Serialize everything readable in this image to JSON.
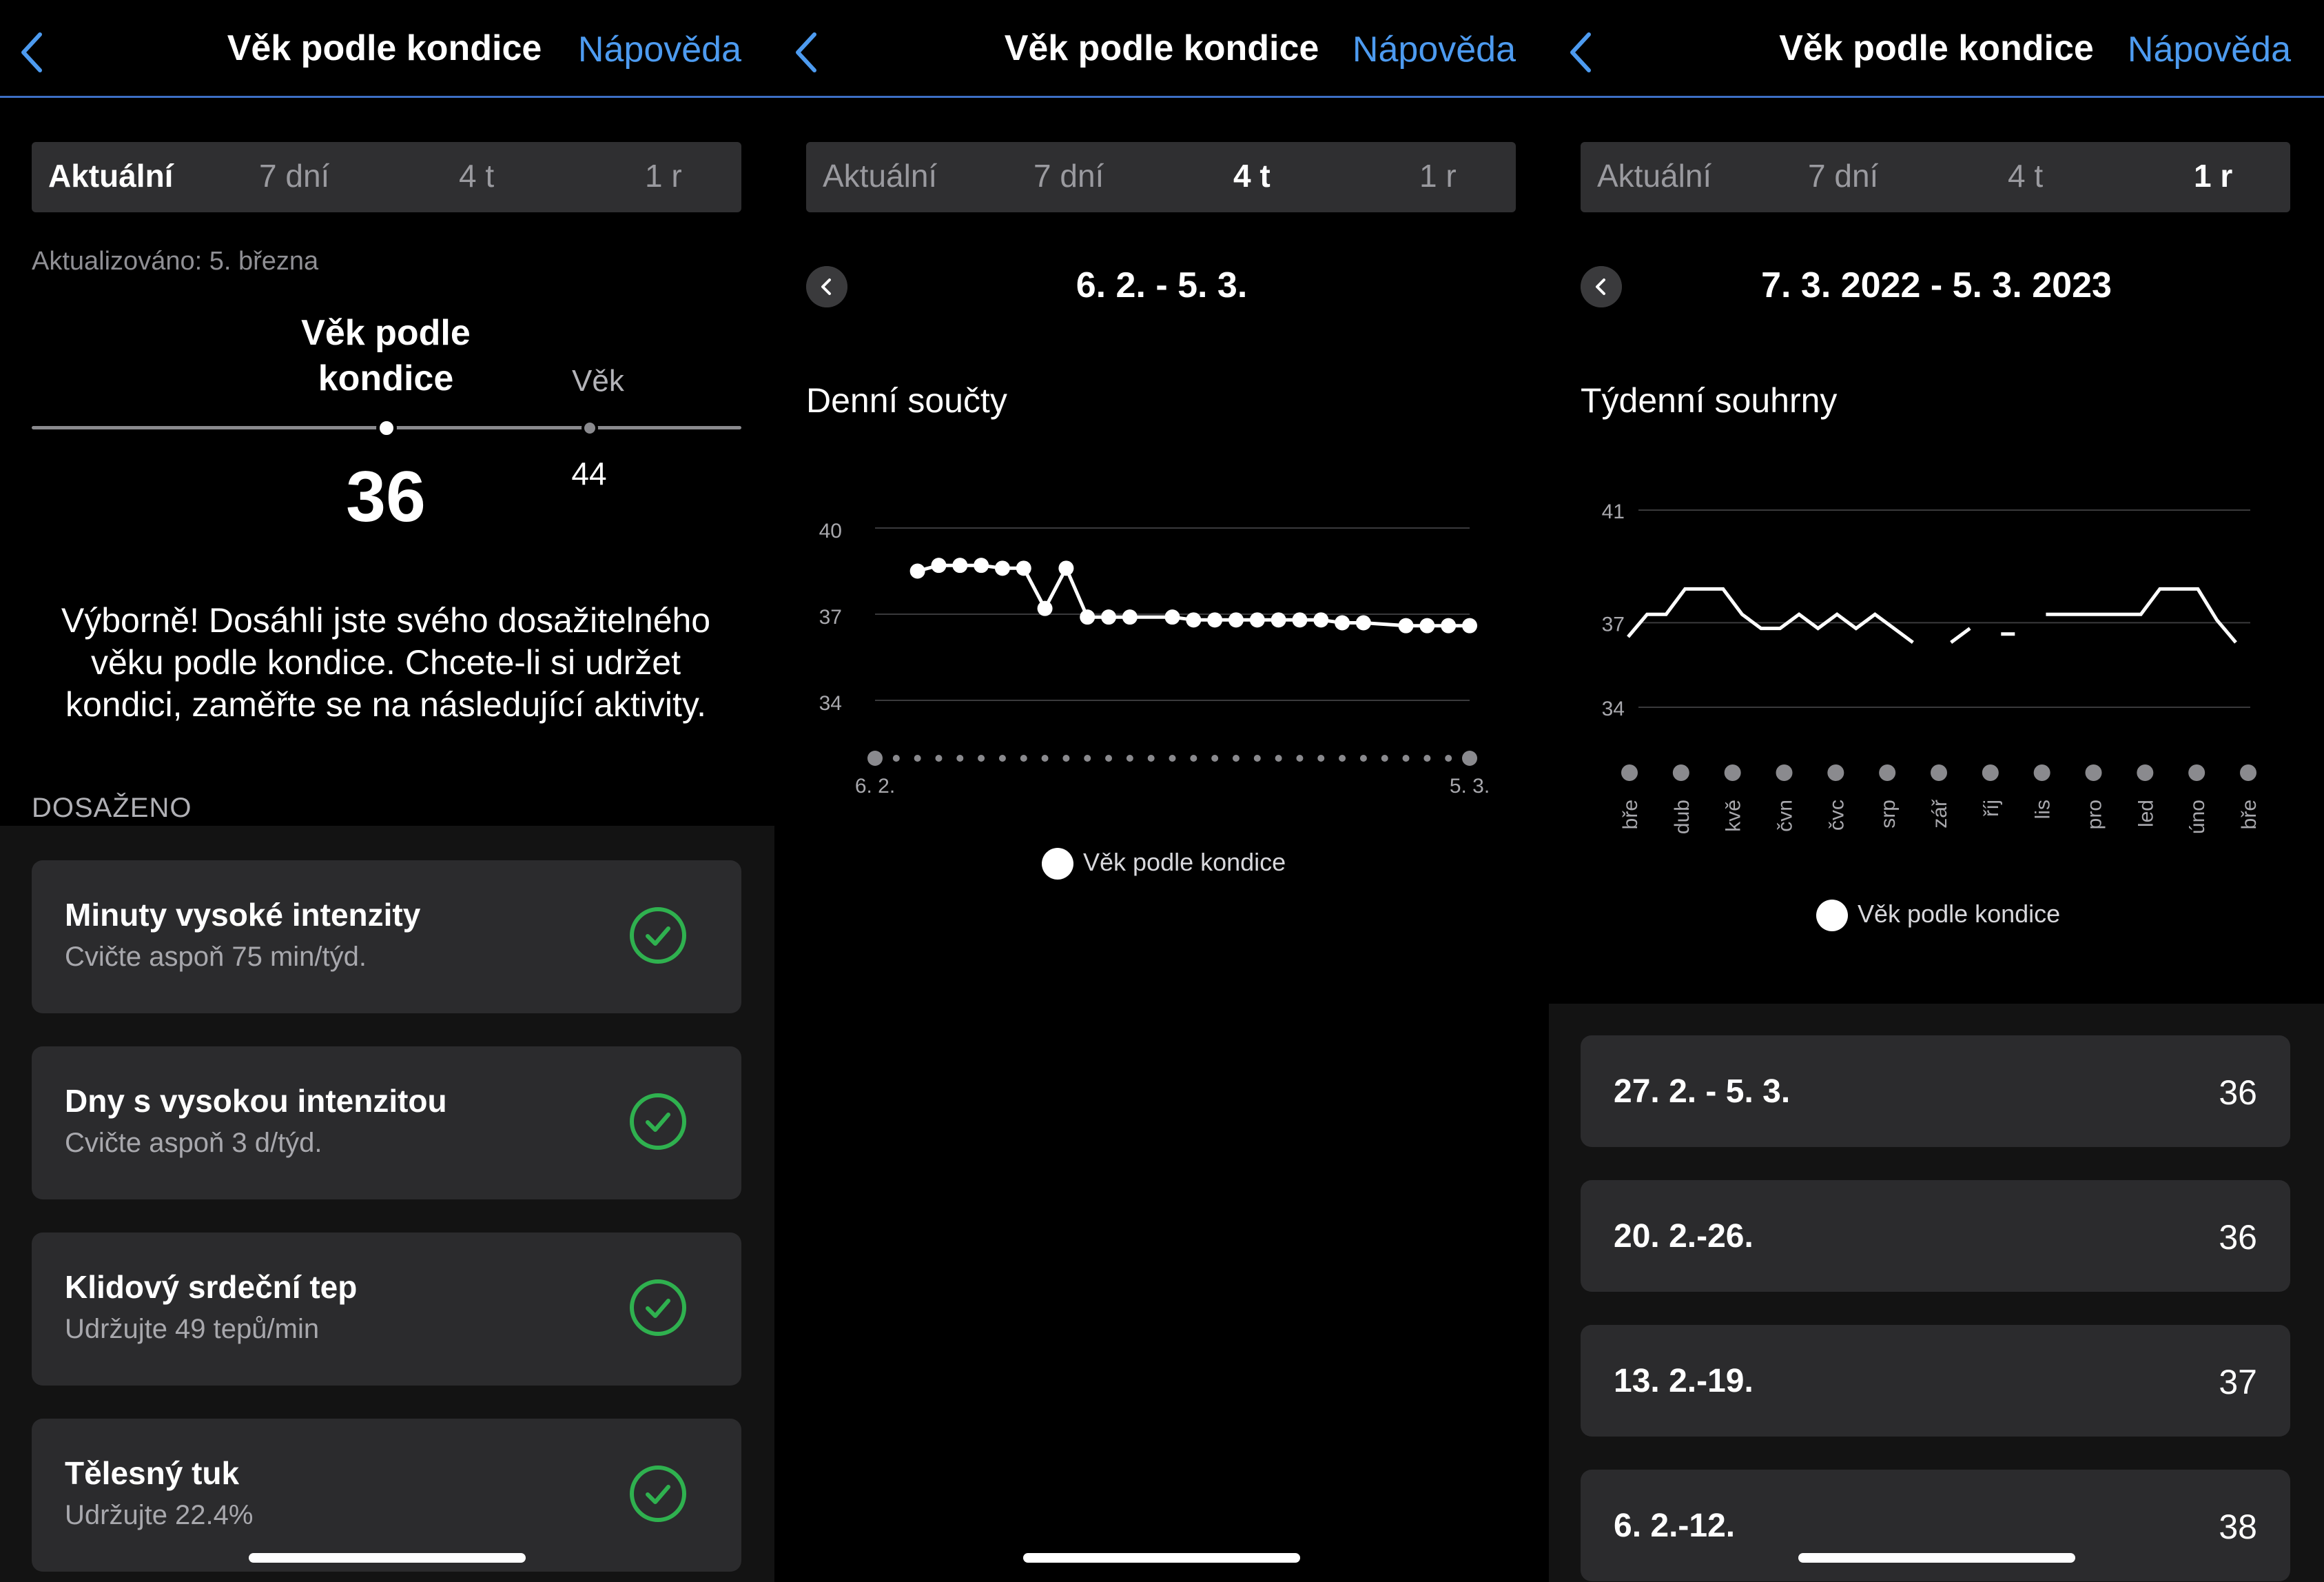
{
  "header": {
    "title": "Věk podle kondice",
    "help": "Nápověda"
  },
  "tabs": [
    "Aktuální",
    "7 dní",
    "4 t",
    "1 r"
  ],
  "current": {
    "updated": "Aktualizováno: 5. března",
    "fitness_age_label_l1": "Věk podle",
    "fitness_age_label_l2": "kondice",
    "age_label": "Věk",
    "fitness_age_value": "36",
    "age_value": "44",
    "message": "Výborně! Dosáhli jste svého dosažitelného věku podle kondice. Chcete-li si udržet kondici, zaměřte se na následující aktivity.",
    "section": "DOSAŽENO",
    "cards": [
      {
        "title": "Minuty vysoké intenzity",
        "sub": "Cvičte aspoň 75 min/týd."
      },
      {
        "title": "Dny s vysokou intenzitou",
        "sub": "Cvičte aspoň 3 d/týd."
      },
      {
        "title": "Klidový srdeční tep",
        "sub": "Udržujte 49 tepů/min"
      },
      {
        "title": "Tělesný tuk",
        "sub": "Udržujte 22.4%"
      }
    ],
    "colors": {
      "check": "#2fb14f",
      "accent": "#4d9bf0"
    }
  },
  "four_weeks": {
    "period": "6. 2. - 5. 3.",
    "chart_title": "Denní součty",
    "legend": "Věk podle kondice"
  },
  "year": {
    "period": "7. 3. 2022 - 5. 3. 2023",
    "chart_title": "Týdenní souhrny",
    "legend": "Věk podle kondice",
    "weeks": [
      {
        "range": "27. 2. - 5. 3.",
        "value": "36"
      },
      {
        "range": "20. 2.-26.",
        "value": "36"
      },
      {
        "range": "13. 2.-19.",
        "value": "37"
      },
      {
        "range": "6. 2.-12.",
        "value": "38"
      }
    ]
  },
  "chart_data": [
    {
      "type": "line",
      "ylim": [
        33,
        40
      ],
      "yticks": [
        "40",
        "37",
        "34"
      ],
      "x_tick_labels": [
        "6. 2.",
        "5. 3."
      ],
      "series": [
        {
          "name": "Věk podle kondice",
          "values": [
            null,
            null,
            38.5,
            38.7,
            38.7,
            38.7,
            38.6,
            38.6,
            37.2,
            38.6,
            36.9,
            36.9,
            36.9,
            null,
            36.9,
            36.8,
            36.8,
            36.8,
            36.8,
            36.8,
            36.8,
            36.8,
            36.7,
            36.7,
            null,
            36.6,
            36.6,
            36.6,
            36.6
          ]
        }
      ]
    },
    {
      "type": "line",
      "ylim": [
        33,
        41
      ],
      "yticks": [
        "41",
        "37",
        "34"
      ],
      "categories": [
        "bře",
        "dub",
        "kvě",
        "čvn",
        "čvc",
        "srp",
        "zář",
        "říj",
        "lis",
        "pro",
        "led",
        "úno",
        "bře"
      ],
      "series": [
        {
          "name": "Věk podle kondice",
          "values": [
            36.5,
            37.3,
            37.3,
            38.2,
            38.2,
            38.2,
            37.3,
            36.8,
            36.8,
            37.3,
            36.8,
            37.3,
            36.8,
            37.3,
            36.8,
            36.3,
            null,
            36.3,
            36.8,
            null,
            36.6,
            null,
            37.3,
            37.3,
            37.3,
            37.3,
            37.3,
            37.3,
            38.2,
            38.2,
            38.2,
            37.1,
            36.3
          ]
        }
      ]
    }
  ]
}
